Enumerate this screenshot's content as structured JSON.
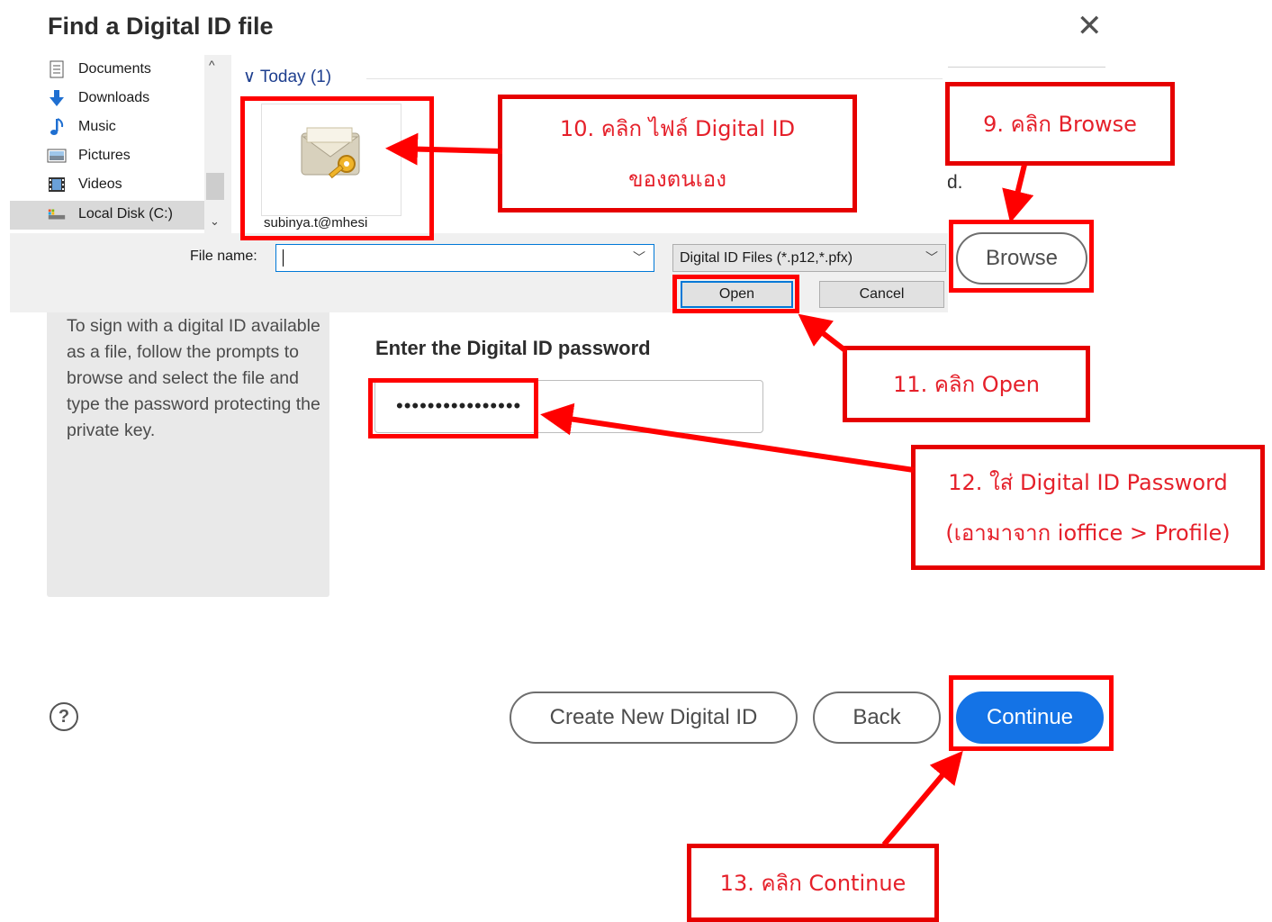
{
  "dialog": {
    "title": "Find a Digital ID file",
    "close_glyph": "✕",
    "trailing_text": "d.",
    "left_panel_text": "To sign with a digital ID available as a file, follow the prompts to browse and select the file and type the password protecting the private key.",
    "password_heading": "Enter the Digital ID password",
    "password_value": "••••••••••••••••",
    "browse_label": "Browse",
    "create_label": "Create New Digital ID",
    "back_label": "Back",
    "continue_label": "Continue",
    "help_glyph": "?"
  },
  "file_dialog": {
    "nav_items": [
      {
        "label": "Documents",
        "icon": "documents-icon"
      },
      {
        "label": "Downloads",
        "icon": "downloads-icon"
      },
      {
        "label": "Music",
        "icon": "music-icon"
      },
      {
        "label": "Pictures",
        "icon": "pictures-icon"
      },
      {
        "label": "Videos",
        "icon": "videos-icon"
      },
      {
        "label": "Local Disk (C:)",
        "icon": "local-disk-icon"
      }
    ],
    "group_label": "∨ Today (1)",
    "file_name": "subinya.t@mhesi",
    "file_name_label": "File name:",
    "file_name_value": "",
    "file_type": "Digital ID Files (*.p12,*.pfx)",
    "open_label": "Open",
    "cancel_label": "Cancel"
  },
  "annotations": {
    "step9": "9. คลิก Browse",
    "step10_line1": "10. คลิก ไฟล์ Digital ID",
    "step10_line2": "ของตนเอง",
    "step11": "11. คลิก Open",
    "step12_line1": "12. ใส่ Digital ID Password",
    "step12_line2": "(เอามาจาก ioffice > Profile)",
    "step13": "13. คลิก Continue"
  },
  "colors": {
    "accent": "#1473e6",
    "annotation": "#ff0000"
  }
}
